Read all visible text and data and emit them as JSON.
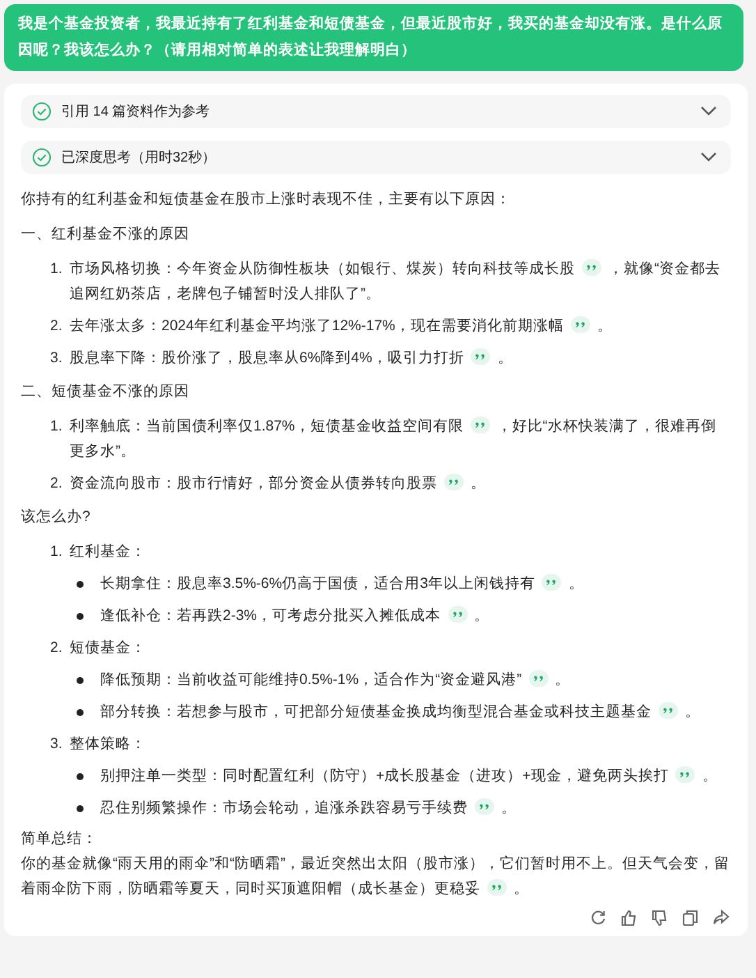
{
  "prompt": "我是个基金投资者，我最近持有了红利基金和短债基金，但最近股市好，我买的基金却没有涨。是什么原因呢？我该怎么办？（请用相对简单的表述让我理解明白）",
  "references": [
    {
      "label": "引用 14 篇资料作为参考",
      "done": true,
      "expanded": false
    },
    {
      "label": "已深度思考（用时32秒）",
      "done": true,
      "expanded": false
    }
  ],
  "intro": "你持有的红利基金和短债基金在股市上涨时表现不佳，主要有以下原因：",
  "sections": [
    {
      "heading": "一、红利基金不涨的原因",
      "items": [
        {
          "number": "1.",
          "text": "市场风格切换：今年资金从防御性板块（如银行、煤炭）转向科技等成长股",
          "cite": true,
          "tail": "，就像“资金都去追网红奶茶店，老牌包子铺暂时没人排队了”。"
        },
        {
          "number": "2.",
          "text": "去年涨太多：2024年红利基金平均涨了12%-17%，现在需要消化前期涨幅",
          "cite": true,
          "tail": "。"
        },
        {
          "number": "3.",
          "text": "股息率下降：股价涨了，股息率从6%降到4%，吸引力打折",
          "cite": true,
          "tail": "。"
        }
      ]
    },
    {
      "heading": "二、短债基金不涨的原因",
      "items": [
        {
          "number": "1.",
          "text": "利率触底：当前国债利率仅1.87%，短债基金收益空间有限",
          "cite": true,
          "tail": "，好比“水杯快装满了，很难再倒更多水”。"
        },
        {
          "number": "2.",
          "text": "资金流向股市：股市行情好，部分资金从债券转向股票",
          "cite": true,
          "tail": "。"
        }
      ]
    }
  ],
  "advice": {
    "heading": "该怎么办?",
    "groups": [
      {
        "number": "1.",
        "title": "红利基金：",
        "bullets": [
          {
            "text": "长期拿住：股息率3.5%-6%仍高于国债，适合用3年以上闲钱持有",
            "cite": true,
            "tail": "。"
          },
          {
            "text": "逢低补仓：若再跌2-3%，可考虑分批买入摊低成本",
            "cite": true,
            "tail": "。"
          }
        ]
      },
      {
        "number": "2.",
        "title": "短债基金：",
        "bullets": [
          {
            "text": "降低预期：当前收益可能维持0.5%-1%，适合作为“资金避风港”",
            "cite": true,
            "tail": "。"
          },
          {
            "text": "部分转换：若想参与股市，可把部分短债基金换成均衡型混合基金或科技主题基金",
            "cite": true,
            "tail": "。"
          }
        ]
      },
      {
        "number": "3.",
        "title": "整体策略：",
        "bullets": [
          {
            "text": "别押注单一类型：同时配置红利（防守）+成长股基金（进攻）+现金，避免两头挨打",
            "cite": true,
            "tail": "。"
          },
          {
            "text": "忍住别频繁操作：市场会轮动，追涨杀跌容易亏手续费",
            "cite": true,
            "tail": "。"
          }
        ]
      }
    ]
  },
  "summary": {
    "heading": "简单总结：",
    "text": "你的基金就像“雨天用的雨伞”和“防晒霜”，最近突然出太阳（股市涨），它们暂时用不上。但天气会变，留着雨伞防下雨，防晒霜等夏天，同时买顶遮阳帽（成长基金）更稳妥",
    "cite": true,
    "tail": "。"
  }
}
